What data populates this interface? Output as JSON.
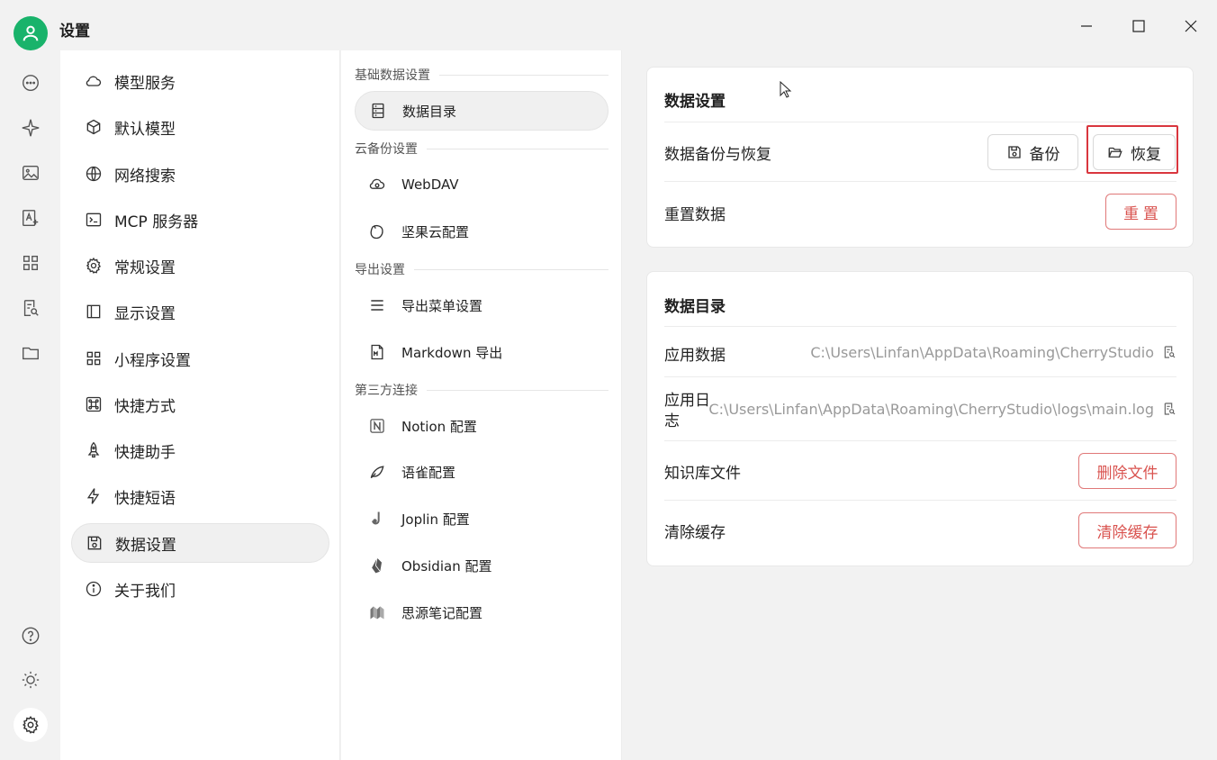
{
  "app": {
    "title": "设置"
  },
  "rail": {
    "top_icons": [
      "chat-bubble-icon",
      "sparkle-icon",
      "image-icon",
      "translate-icon",
      "apps-grid-icon",
      "document-search-icon",
      "folder-icon"
    ],
    "bottom_icons": [
      "help-icon",
      "sun-icon",
      "gear-icon"
    ]
  },
  "nav": {
    "items": [
      {
        "label": "模型服务",
        "icon": "cloud-icon"
      },
      {
        "label": "默认模型",
        "icon": "cube-icon"
      },
      {
        "label": "网络搜索",
        "icon": "globe-icon"
      },
      {
        "label": "MCP 服务器",
        "icon": "terminal-icon"
      },
      {
        "label": "常规设置",
        "icon": "gear-icon"
      },
      {
        "label": "显示设置",
        "icon": "layout-icon"
      },
      {
        "label": "小程序设置",
        "icon": "grid-icon"
      },
      {
        "label": "快捷方式",
        "icon": "command-icon"
      },
      {
        "label": "快捷助手",
        "icon": "rocket-icon"
      },
      {
        "label": "快捷短语",
        "icon": "bolt-icon"
      },
      {
        "label": "数据设置",
        "icon": "save-icon"
      },
      {
        "label": "关于我们",
        "icon": "info-icon"
      }
    ],
    "active_index": 10
  },
  "sub": {
    "groups": {
      "basic": "基础数据设置",
      "cloud": "云备份设置",
      "export": "导出设置",
      "third": "第三方连接"
    },
    "items": {
      "data_dir": "数据目录",
      "webdav": "WebDAV",
      "jianguoyun": "坚果云配置",
      "export_menu": "导出菜单设置",
      "markdown": "Markdown 导出",
      "notion": "Notion 配置",
      "yuque": "语雀配置",
      "joplin": "Joplin 配置",
      "obsidian": "Obsidian 配置",
      "siyuan": "思源笔记配置"
    }
  },
  "data_settings": {
    "title": "数据设置",
    "backup_label": "数据备份与恢复",
    "backup_button": "备份",
    "restore_button": "恢复",
    "reset_label": "重置数据",
    "reset_button": "重 置"
  },
  "data_dir": {
    "title": "数据目录",
    "app_data_label": "应用数据",
    "app_data_path": "C:\\Users\\Linfan\\AppData\\Roaming\\CherryStudio",
    "app_log_label_1": "应用日",
    "app_log_label_2": "志",
    "app_log_path": "C:\\Users\\Linfan\\AppData\\Roaming\\CherryStudio\\logs\\main.log",
    "kb_label": "知识库文件",
    "kb_button": "删除文件",
    "cache_label": "清除缓存",
    "cache_button": "清除缓存"
  },
  "colors": {
    "accent_green": "#19b36b",
    "danger": "#d9534f",
    "focus_ring": "#d9363e"
  }
}
